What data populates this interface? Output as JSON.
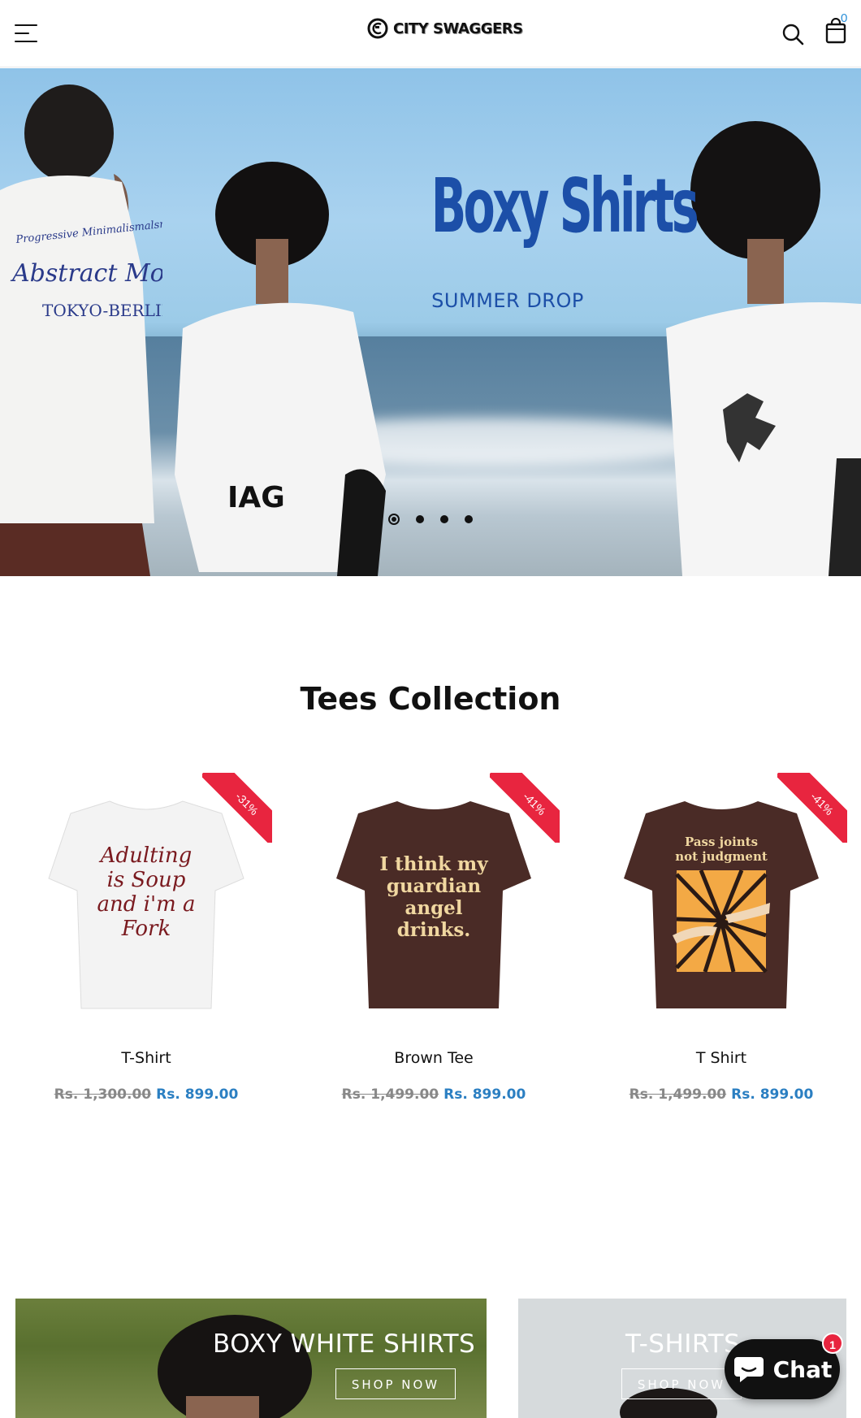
{
  "header": {
    "logo_text": "CITY SWAGGERS",
    "cart_count": "0"
  },
  "hero": {
    "title": "Boxy Shirts",
    "subtitle": "SUMMER DROP",
    "shirt_print_lines": [
      "Progressive Minimalismalsm",
      "Abstract Mod",
      "TOKYO-BERLIN"
    ],
    "slide_count": 4,
    "active_slide": 0
  },
  "collection": {
    "title": "Tees Collection",
    "products": [
      {
        "name": "T-Shirt",
        "badge": "-31%",
        "old_price": "Rs. 1,300.00",
        "price": "Rs. 899.00",
        "print": [
          "Adulting",
          "is Soup",
          "and i'm a",
          "Fork"
        ],
        "color": "#f2f2f2"
      },
      {
        "name": "Brown Tee",
        "badge": "-41%",
        "old_price": "Rs. 1,499.00",
        "price": "Rs. 899.00",
        "print": [
          "I think my",
          "guardian",
          "angel",
          "drinks."
        ],
        "color": "#4a2b26"
      },
      {
        "name": "T Shirt",
        "badge": "-41%",
        "old_price": "Rs. 1,499.00",
        "price": "Rs. 899.00",
        "print": [
          "Pass joints",
          "not judgment"
        ],
        "color": "#4a2b26"
      }
    ]
  },
  "banners": [
    {
      "title": "BOXY WHITE SHIRTS",
      "button": "SHOP NOW"
    },
    {
      "title": "T-SHIRTS",
      "button": "SHOP NOW"
    }
  ],
  "chat": {
    "label": "Chat",
    "badge": "1"
  },
  "colors": {
    "accent_blue": "#2b7fc2",
    "sale_red": "#e8253f",
    "hero_blue": "#1c4fa8"
  },
  "icons": [
    "hamburger-menu-icon",
    "search-icon",
    "shopping-bag-icon",
    "chat-bubble-icon"
  ]
}
